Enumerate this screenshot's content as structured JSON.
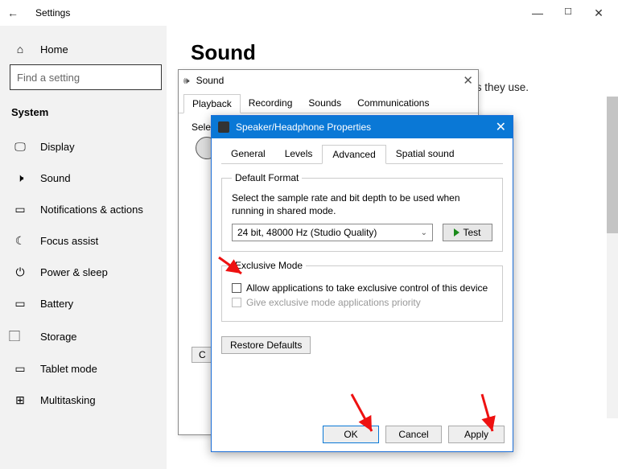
{
  "settings": {
    "title": "Settings",
    "search_placeholder": "Find a setting",
    "category": "System",
    "home_label": "Home",
    "nav": [
      {
        "icon": "display",
        "label": "Display"
      },
      {
        "icon": "sound",
        "label": "Sound"
      },
      {
        "icon": "notify",
        "label": "Notifications & actions"
      },
      {
        "icon": "focus",
        "label": "Focus assist"
      },
      {
        "icon": "power",
        "label": "Power & sleep"
      },
      {
        "icon": "battery",
        "label": "Battery"
      },
      {
        "icon": "storage",
        "label": "Storage"
      },
      {
        "icon": "tablet",
        "label": "Tablet mode"
      },
      {
        "icon": "multi",
        "label": "Multitasking"
      }
    ]
  },
  "content": {
    "heading": "Sound",
    "snippet": "or devices they use."
  },
  "sound_dialog": {
    "title": "Sound",
    "tabs": [
      "Playback",
      "Recording",
      "Sounds",
      "Communications"
    ],
    "active_tab": "Playback",
    "select_text": "Sele",
    "configure_btn": "C"
  },
  "props_dialog": {
    "title": "Speaker/Headphone Properties",
    "tabs": [
      "General",
      "Levels",
      "Advanced",
      "Spatial sound"
    ],
    "active_tab": "Advanced",
    "default_format": {
      "legend": "Default Format",
      "desc": "Select the sample rate and bit depth to be used when running in shared mode.",
      "selected": "24 bit, 48000 Hz (Studio Quality)",
      "test_btn": "Test"
    },
    "exclusive": {
      "legend": "Exclusive Mode",
      "opt1": "Allow applications to take exclusive control of this device",
      "opt2": "Give exclusive mode applications priority"
    },
    "restore_btn": "Restore Defaults",
    "buttons": {
      "ok": "OK",
      "cancel": "Cancel",
      "apply": "Apply"
    }
  }
}
